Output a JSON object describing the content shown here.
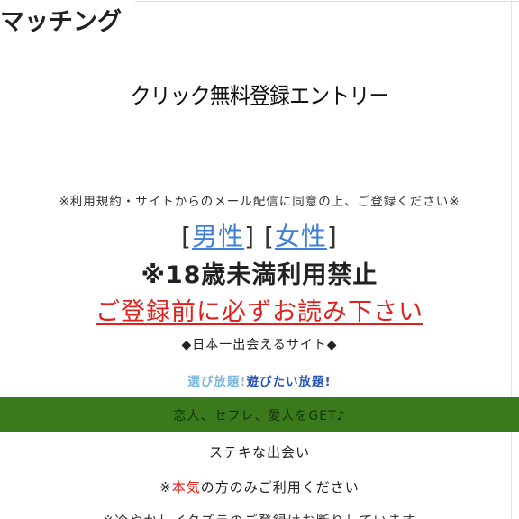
{
  "header": {
    "title": "マッチング"
  },
  "entry": {
    "title": "クリック無料登録エントリー"
  },
  "consent": {
    "text": "※利用規約・サイトからのメール配信に同意の上、ご登録ください※"
  },
  "gender": {
    "open_bracket_1": "[",
    "male_label": "男性",
    "close_bracket_1": "]",
    "open_bracket_2": "[",
    "female_label": "女性",
    "close_bracket_2": "]"
  },
  "notices": {
    "age_limit": "※18歳未満利用禁止",
    "read_before": "ご登録前に必ずお読み下さい",
    "best_site": "◆日本一出会えるサイト◆"
  },
  "choose": {
    "part1": "選び放題",
    "separator": "!",
    "part2": "遊びたい放題!"
  },
  "banner": {
    "text": "恋人、セフレ、愛人をGET♪"
  },
  "features": {
    "suteki": "ステキな出会い",
    "serious_prefix": "※",
    "serious_highlight": "本気",
    "serious_suffix": "の方のみご利用ください",
    "cutoff": "※冷やかしイタズラのご登録はお断りしています"
  },
  "colors": {
    "link_blue": "#3f7fd8",
    "warning_red": "#e0201c",
    "banner_green": "#3a7a1c",
    "light_blue": "#7ab6de",
    "dark_blue": "#2a55b8"
  }
}
